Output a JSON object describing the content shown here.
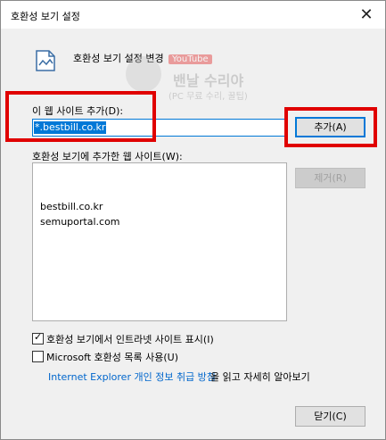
{
  "window": {
    "title": "호환성 보기 설정"
  },
  "header": {
    "text": "호환성 보기 설정 변경"
  },
  "watermark": {
    "yt": "YouTube",
    "title": "밴날 수리야",
    "sub": "(PC 무료 수리, 꿀팁)"
  },
  "add_site": {
    "label": "이 웹 사이트 추가(D):",
    "value": "*.bestbill.co.kr",
    "add_button": "추가(A)"
  },
  "site_list": {
    "label": "호환성 보기에 추가한 웹 사이트(W):",
    "items": [
      "bestbill.co.kr",
      "semuportal.com"
    ],
    "remove_button": "제거(R)"
  },
  "options": {
    "intranet": {
      "label": "호환성 보기에서 인트라넷 사이트 표시(I)",
      "checked": true
    },
    "ms_list": {
      "label": "Microsoft 호환성 목록 사용(U)",
      "checked": false
    }
  },
  "privacy": {
    "link": "Internet Explorer 개인 정보 취급 방침",
    "suffix": "을 읽고 자세히 알아보기"
  },
  "close_button": "닫기(C)",
  "colors": {
    "accent": "#0078d7",
    "highlight": "#e00000",
    "link": "#0066cc"
  }
}
